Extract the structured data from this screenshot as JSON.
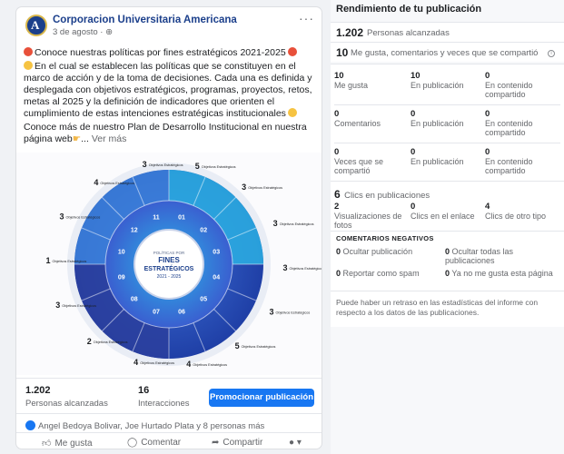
{
  "post": {
    "page_name": "Corporacion Universitaria Americana",
    "date": "3 de agosto · ",
    "menu_glyph": "···",
    "logo_letter": "A",
    "text_line1": "Conoce nuestras políticas por fines estratégicos 2021-2025",
    "text_body": "En el cual se establecen las políticas que se constituyen en el marco de acción y de la toma de decisiones. Cada una es definida y desplegada con objetivos estratégicos, programas, proyectos, retos, metas al 2025 y la definición de indicadores que orienten el cumplimiento de estas intenciones estratégicas institucionales",
    "text_cta": "Conoce más de nuestro Plan de Desarrollo Institucional en nuestra página web",
    "see_more": "Ver más",
    "infographic": {
      "center_line1": "POLÍTICAS POR",
      "center_line2": "FINES",
      "center_line3": "ESTRATÉGICOS",
      "center_line4": "2021 - 2025",
      "numbers": [
        "01",
        "02",
        "03",
        "04",
        "05",
        "06",
        "07",
        "08",
        "09",
        "10",
        "11",
        "12"
      ],
      "objective_counts": [
        "5",
        "3",
        "3",
        "3",
        "3",
        "5",
        "4",
        "4",
        "2",
        "3",
        "1",
        "3",
        "4",
        "3"
      ],
      "objective_label": "Objetivos Estratégicos"
    },
    "reach_value": "1.202",
    "reach_label": "Personas alcanzadas",
    "interactions_value": "16",
    "interactions_label": "Interacciones",
    "promote_label": "Promocionar publicación",
    "reactions_text": "Angel Bedoya Bolivar, Joe Hurtado Plata y 8 personas más",
    "like_label": "Me gusta",
    "comment_label": "Comentar",
    "share_label": "Compartir"
  },
  "panel": {
    "title": "Rendimiento de tu publicación",
    "reach_value": "1.202",
    "reach_label": "Personas alcanzadas",
    "engagement_value": "10",
    "engagement_label": "Me gusta, comentarios y veces que se compartió",
    "likes": {
      "total": "10",
      "total_label": "Me gusta",
      "on_post": "10",
      "on_post_label": "En publicación",
      "on_shared": "0",
      "on_shared_label": "En contenido compartido"
    },
    "comments": {
      "total": "0",
      "total_label": "Comentarios",
      "on_post": "0",
      "on_post_label": "En publicación",
      "on_shared": "0",
      "on_shared_label": "En contenido compartido"
    },
    "shares": {
      "total": "0",
      "total_label": "Veces que se compartió",
      "on_post": "0",
      "on_post_label": "En publicación",
      "on_shared": "0",
      "on_shared_label": "En contenido compartido"
    },
    "clicks_value": "6",
    "clicks_label": "Clics en publicaciones",
    "photo_views": "2",
    "photo_views_label": "Visualizaciones de fotos",
    "link_clicks": "0",
    "link_clicks_label": "Clics en el enlace",
    "other_clicks": "4",
    "other_clicks_label": "Clics de otro tipo",
    "negative_header": "COMENTARIOS NEGATIVOS",
    "hide_post": "0",
    "hide_post_label": "Ocultar publicación",
    "hide_all": "0",
    "hide_all_label": "Ocultar todas las publicaciones",
    "report_spam": "0",
    "report_spam_label": "Reportar como spam",
    "unlike_page": "0",
    "unlike_page_label": "Ya no me gusta esta página",
    "note": "Puede haber un retraso en las estadísticas del informe con respecto a los datos de las publicaciones."
  }
}
